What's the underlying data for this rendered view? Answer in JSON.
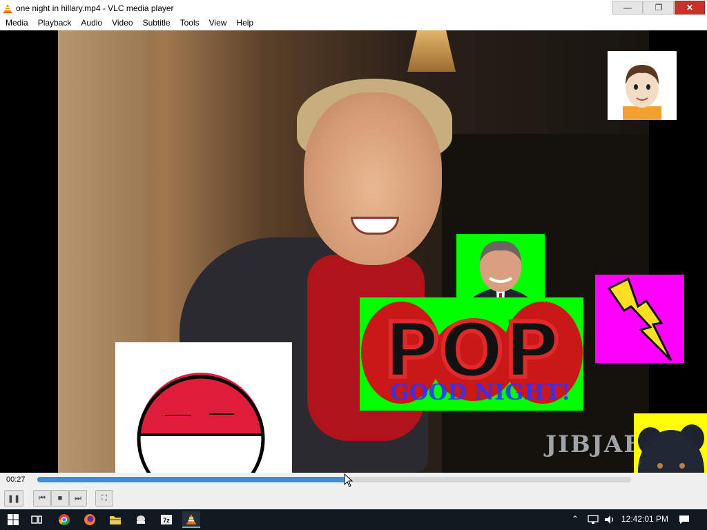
{
  "window": {
    "title": "one night in hillary.mp4 - VLC media player",
    "controls": {
      "minimize": "—",
      "maximize": "❐",
      "close": "✕"
    }
  },
  "menu": {
    "items": [
      "Media",
      "Playback",
      "Audio",
      "Video",
      "Subtitle",
      "Tools",
      "View",
      "Help"
    ]
  },
  "video": {
    "watermark": "JIBJAB",
    "overlays": {
      "pop_text": "POP",
      "goodnight_text": "GOOD NIGHT!"
    }
  },
  "player": {
    "elapsed": "00:27",
    "progress": 0.52,
    "buttons": {
      "pause": "❚❚",
      "prev": "⏮",
      "stop": "■",
      "next": "⏭",
      "fullscreen": "⛶"
    }
  },
  "taskbar": {
    "clock": "12:42:01 PM",
    "apps": [
      "start",
      "task-view",
      "chrome",
      "firefox",
      "file-explorer",
      "app-5",
      "7zip",
      "vlc"
    ]
  },
  "colors": {
    "accent": "#3a8fd8",
    "close": "#c9302c",
    "green_screen": "#00ff00",
    "magenta": "#ff00ff",
    "yellow": "#ffff00"
  }
}
